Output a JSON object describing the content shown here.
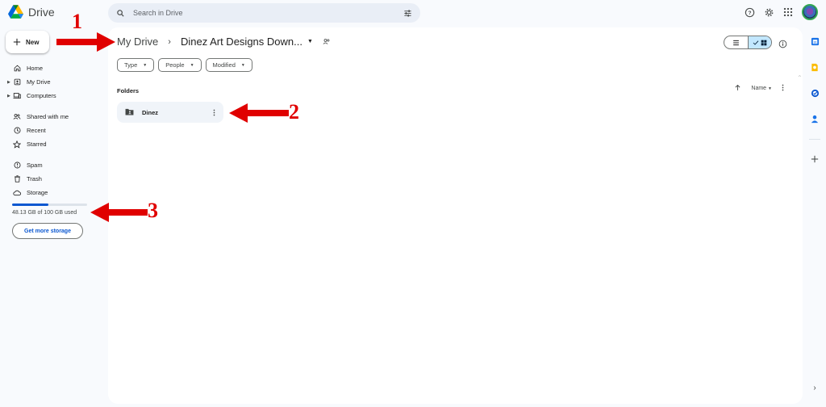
{
  "app": {
    "name": "Drive"
  },
  "search": {
    "placeholder": "Search in Drive"
  },
  "new_button": {
    "label": "New"
  },
  "sidebar": {
    "items": [
      {
        "label": "Home",
        "icon": "home-icon"
      },
      {
        "label": "My Drive",
        "icon": "my-drive-icon"
      },
      {
        "label": "Computers",
        "icon": "computer-icon"
      },
      {
        "label": "Shared with me",
        "icon": "people-icon"
      },
      {
        "label": "Recent",
        "icon": "clock-icon"
      },
      {
        "label": "Starred",
        "icon": "star-icon"
      },
      {
        "label": "Spam",
        "icon": "spam-icon"
      },
      {
        "label": "Trash",
        "icon": "trash-icon"
      },
      {
        "label": "Storage",
        "icon": "cloud-icon"
      }
    ]
  },
  "storage": {
    "used_text": "48.13 GB of 100 GB used",
    "used_fraction": 0.4813,
    "button_label": "Get more storage"
  },
  "breadcrumb": {
    "root": "My Drive",
    "current": "Dinez Art Designs Down..."
  },
  "filters": [
    {
      "label": "Type"
    },
    {
      "label": "People"
    },
    {
      "label": "Modified"
    }
  ],
  "folders": {
    "section_label": "Folders",
    "sort_label": "Name",
    "items": [
      {
        "name": "Dinez"
      }
    ]
  },
  "annotations": [
    {
      "number": "1"
    },
    {
      "number": "2"
    },
    {
      "number": "3"
    }
  ],
  "colors": {
    "accent": "#0b57d0",
    "arrow": "#e00000",
    "selected_view": "#c2e7ff"
  }
}
